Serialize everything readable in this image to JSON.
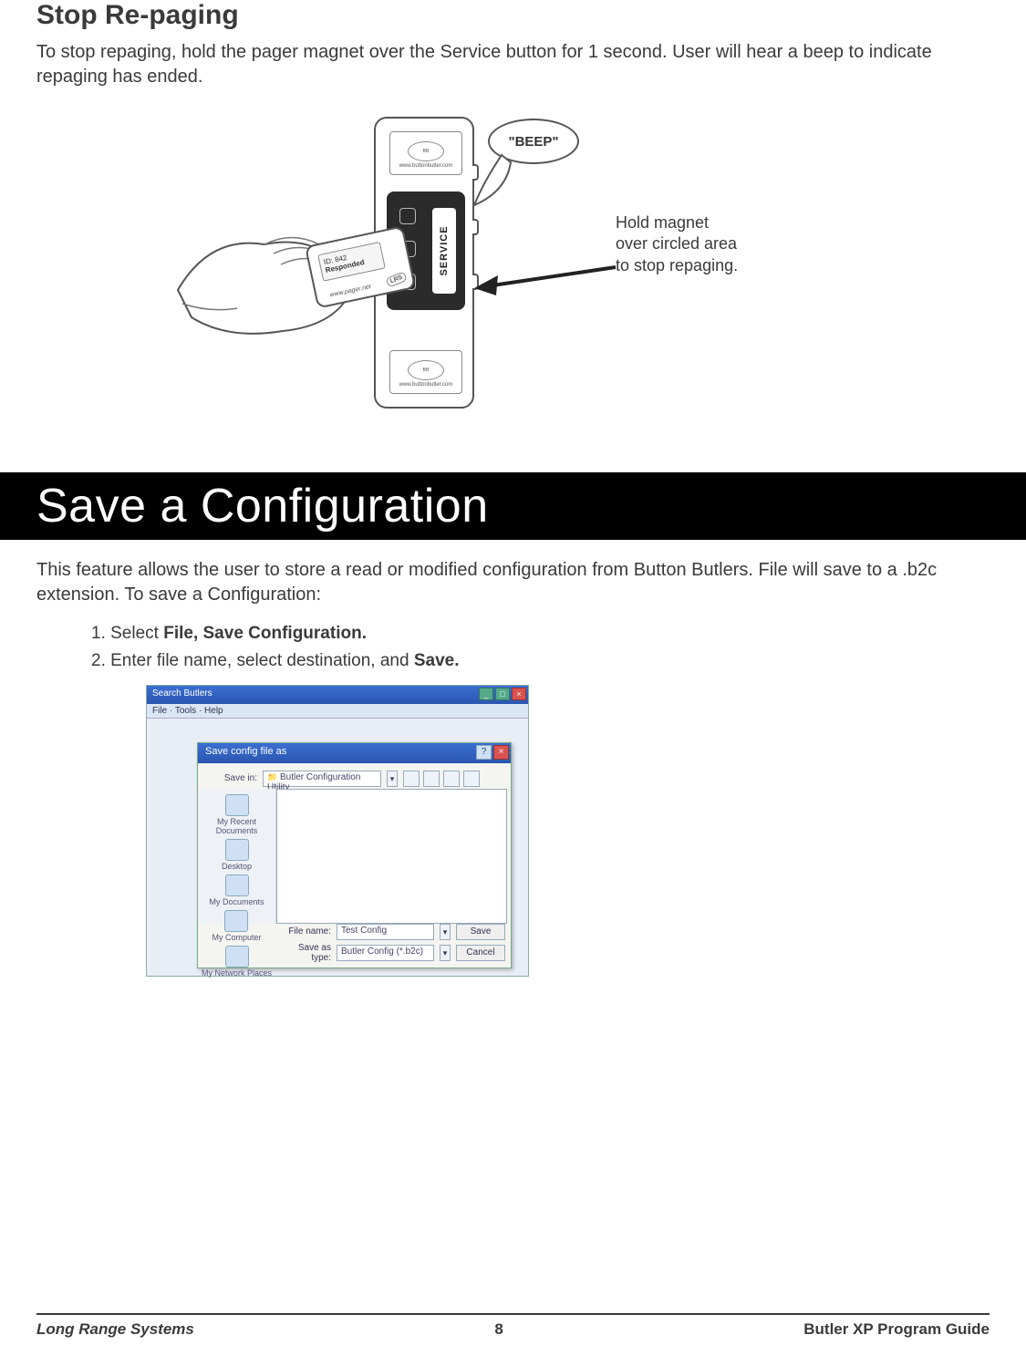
{
  "section1": {
    "title": "Stop Re-paging",
    "body": "To stop repaging, hold the pager magnet over the Service button for 1 second.  User will hear a beep to indicate repaging has ended.",
    "bubble": "\"BEEP\"",
    "caption_l1": "Hold magnet",
    "caption_l2": "over circled area",
    "caption_l3": "to stop repaging.",
    "device_url": "www.buttonbutler.com",
    "service_label": "SERVICE",
    "pager_msg_line1": "ID: 842",
    "pager_msg_line2": "Responded",
    "pager_url": "www.pager.net",
    "pager_brand": "LRS"
  },
  "section2": {
    "title": "Save a Configuration",
    "body": "This feature allows the user to store a read or modified configuration from Button Butlers.  File will save to a .b2c extension.  To save a Configuration:",
    "step1_prefix": "1. Select ",
    "step1_bold": "File, Save Configuration.",
    "step2_prefix": "2. Enter file name, select destination, and ",
    "step2_bold": "Save."
  },
  "screenshot": {
    "app_title": "Search Butlers",
    "menu": "File · Tools · Help",
    "dialog_title": "Save config file as",
    "savein_label": "Save in:",
    "savein_value": "Butler Configuration Utility",
    "places": {
      "recent": "My Recent Documents",
      "desktop": "Desktop",
      "mydocs": "My Documents",
      "mycomp": "My Computer",
      "mynet": "My Network Places"
    },
    "filename_label": "File name:",
    "filename_value": "Test Config",
    "type_label": "Save as type:",
    "type_value": "Butler Config (*.b2c)",
    "save_btn": "Save",
    "cancel_btn": "Cancel"
  },
  "footer": {
    "left": "Long Range Systems",
    "center": "8",
    "right": "Butler XP Program Guide"
  }
}
